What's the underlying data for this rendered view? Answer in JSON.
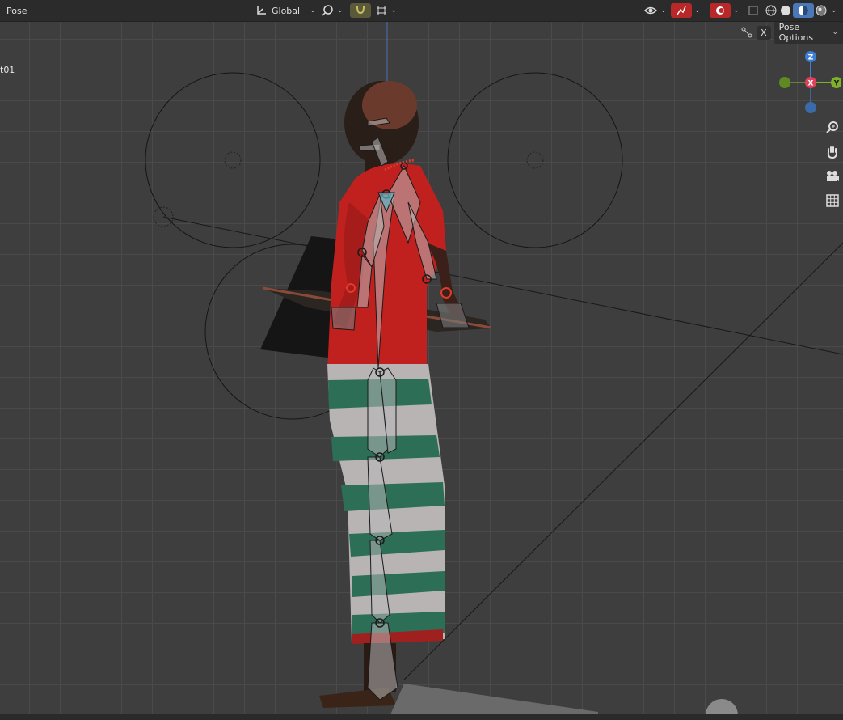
{
  "header": {
    "mode_label": "Pose",
    "transform_orientation": "Global",
    "pose_options_label": "Pose Options",
    "close_label": "X"
  },
  "viewport": {
    "object_label": "t01"
  },
  "gizmo": {
    "axis_x": "X",
    "axis_y": "Y",
    "axis_z": "Z",
    "color_x": "#e0415a",
    "color_y": "#7fb02a",
    "color_z": "#3b7fd6"
  },
  "icons": {
    "transform": "transform-orientation-icon",
    "pivot": "pivot-icon",
    "snap": "snap-magnet-icon",
    "proportional": "proportional-editing-icon",
    "visibility": "eye-icon",
    "gizmo": "gizmo-toggle-icon",
    "overlay": "overlay-icon",
    "xray": "xray-icon",
    "zoom": "zoom-icon",
    "pan": "hand-pan-icon",
    "camera": "camera-icon",
    "grid": "grid-icon"
  }
}
